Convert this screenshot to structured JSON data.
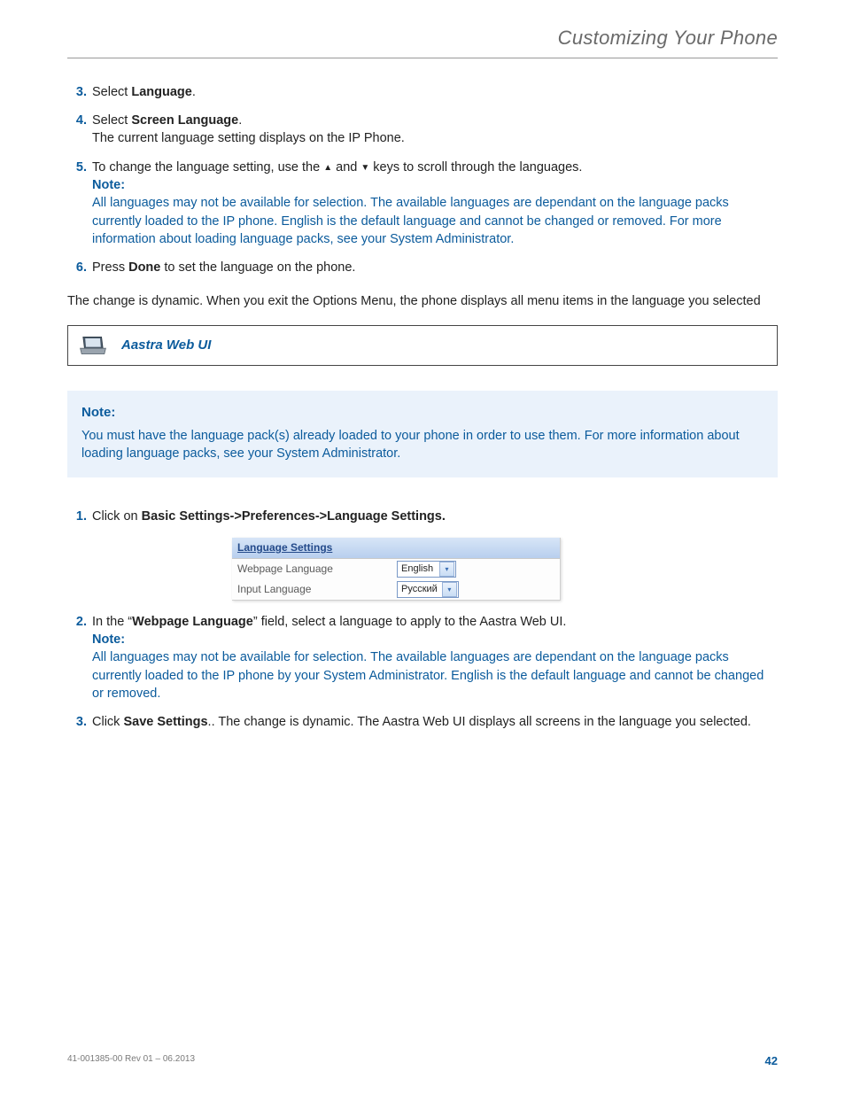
{
  "header": {
    "title": "Customizing Your Phone"
  },
  "phone_steps": [
    {
      "num": "3.",
      "text_pre": "Select ",
      "bold": "Language",
      "text_post": "."
    },
    {
      "num": "4.",
      "text_pre": "Select ",
      "bold": "Screen Language",
      "text_post": ".",
      "line2": "The current language setting displays on the IP Phone."
    },
    {
      "num": "5.",
      "text_pre": "To change the language setting, use the ",
      "arrow1": "▲",
      "mid": " and ",
      "arrow2": "▼",
      "text_post": " keys to scroll through the languages.",
      "note_label": "Note:",
      "note_text": "All languages may not be available for selection. The available languages are dependant on the language packs currently loaded to the IP phone. English is the default language and cannot be changed or removed. For more information about loading language packs, see your System Administrator."
    },
    {
      "num": "6.",
      "text_pre": "Press ",
      "bold": "Done",
      "text_post": " to set the language on the phone."
    }
  ],
  "change_dynamic": "The change is dynamic. When you exit the Options Menu, the phone displays all menu items in the language you selected",
  "webui_title": "Aastra Web UI",
  "note_box": {
    "label": "Note:",
    "text": "You must have the language pack(s) already loaded to your phone in order to use them. For more information about loading language packs, see your System Administrator."
  },
  "web_steps": {
    "s1": {
      "num": "1.",
      "pre": "Click on ",
      "bold": "Basic Settings->Preferences->Language Settings."
    },
    "s2": {
      "num": "2.",
      "pre": "In the “",
      "bold": "Webpage Language",
      "post": "” field, select a language to apply to the Aastra Web UI.",
      "note_label": "Note:",
      "note_text": "All languages may not be available for selection. The available languages are dependant on the language packs currently loaded to the IP phone by your System Administrator. English is the default language and cannot be changed or removed."
    },
    "s3": {
      "num": "3.",
      "pre": "Click ",
      "bold": "Save Settings",
      "post": ".. The change is dynamic. The Aastra Web UI displays all screens in the language you selected."
    }
  },
  "settings_panel": {
    "header": "Language Settings",
    "rows": [
      {
        "label": "Webpage Language",
        "value": "English"
      },
      {
        "label": "Input Language",
        "value": "Русский"
      }
    ]
  },
  "footer": {
    "rev": "41-001385-00 Rev 01 – 06.2013",
    "page": "42"
  }
}
